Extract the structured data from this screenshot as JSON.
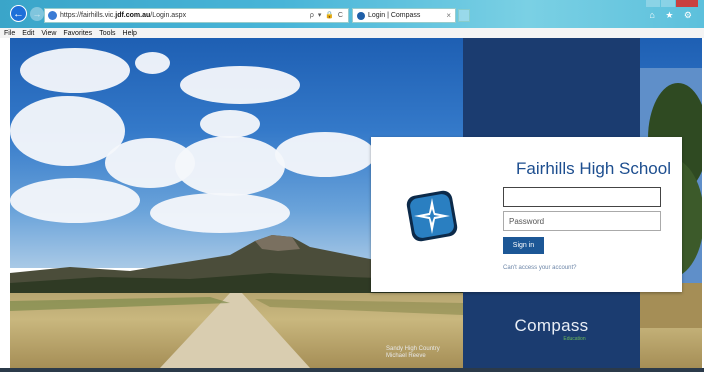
{
  "browser": {
    "address_prefix": "https://fairhills.vic.",
    "address_host": "jdf.com.au",
    "address_path": "/Login.aspx",
    "address_controls": "ρ ▾ 🔒 C",
    "tab_title": "Login | Compass",
    "tab_close": "×",
    "top_icons": "⌂ ★ ⚙",
    "back_icon": "←",
    "forward_icon": "→"
  },
  "menu": [
    "File",
    "Edit",
    "View",
    "Favorites",
    "Tools",
    "Help"
  ],
  "login": {
    "school_name": "Fairhills High School",
    "username_value": "",
    "password_placeholder": "Password",
    "signin_label": "Sign in",
    "forgot_link": "Can't access your account?"
  },
  "brand": {
    "name": "Compass",
    "sub": "Education"
  },
  "photo_credit": {
    "line1": "Sandy High Country",
    "line2": "Michael Reeve"
  },
  "colors": {
    "navy_panel": "#1b3c70",
    "signin_button": "#1c5796",
    "school_title": "#1d4e8f"
  },
  "icons": {
    "logo": "compass-star-icon",
    "favicon": "compass-favicon-icon"
  }
}
